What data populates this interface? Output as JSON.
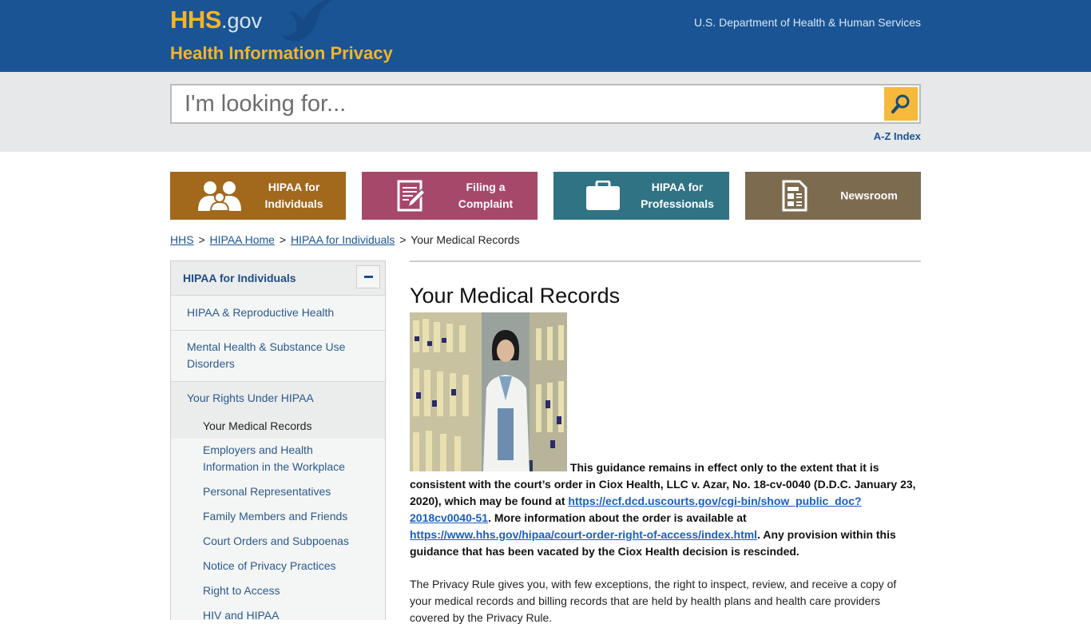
{
  "header": {
    "logo_main": "HHS",
    "logo_suffix": ".gov",
    "site_title": "Health Information Privacy",
    "department": "U.S. Department of Health & Human Services"
  },
  "search": {
    "placeholder": "I'm looking for...",
    "value": "",
    "button_icon": "search-icon",
    "az_index_label": "A-Z Index"
  },
  "colors": {
    "header_bg": "#1a5494",
    "accent_gold": "#f6b428",
    "btn_individuals": "#a2681c",
    "btn_complaint": "#a6486a",
    "btn_professionals": "#2f7385",
    "btn_newsroom": "#7d6b50"
  },
  "big_nav": [
    {
      "line1": "HIPAA for",
      "line2": "Individuals",
      "icon": "people-icon"
    },
    {
      "line1": "Filing a",
      "line2": "Complaint",
      "icon": "form-pencil-icon"
    },
    {
      "line1": "HIPAA for",
      "line2": "Professionals",
      "icon": "briefcase-icon"
    },
    {
      "line1": "Newsroom",
      "line2": "",
      "icon": "newspaper-icon"
    }
  ],
  "breadcrumb": {
    "items": [
      "HHS",
      "HIPAA Home",
      "HIPAA for Individuals"
    ],
    "current": "Your Medical Records",
    "separator": ">"
  },
  "sidebar": {
    "heading": "HIPAA for Individuals",
    "collapse_icon": "minus-icon",
    "items": [
      "HIPAA & Reproductive Health",
      "Mental Health & Substance Use Disorders"
    ],
    "group": "Your Rights Under HIPAA",
    "active": "Your Medical Records",
    "subitems": [
      "Employers and Health Information in the Workplace",
      "Personal Representatives",
      "Family Members and Friends",
      "Court Orders and Subpoenas",
      "Notice of Privacy Practices",
      "Right to Access",
      "HIV and HIPAA"
    ]
  },
  "main": {
    "title": "Your Medical Records",
    "image_alt": "Medical records staff member standing between shelves of file folders",
    "notice": {
      "part1": "This guidance remains in effect only to the extent that it is consistent with the court’s order in Ciox Health, LLC v. Azar, No. 18-cv-0040 (D.D.C. January 23, 2020), which may be found at ",
      "link1": "https://ecf.dcd.uscourts.gov/cgi-bin/show_public_doc?2018cv0040-51",
      "part2": ". More information about the order is available at ",
      "link2": "https://www.hhs.gov/hipaa/court-order-right-of-access/index.html",
      "part3": ". Any provision within this guidance that has been vacated by the Ciox Health decision is rescinded."
    },
    "paragraph1": "The Privacy Rule gives you, with few exceptions, the right to inspect, review, and receive a copy of your medical records and billing records that are held by health plans and health care providers covered by the Privacy Rule."
  }
}
